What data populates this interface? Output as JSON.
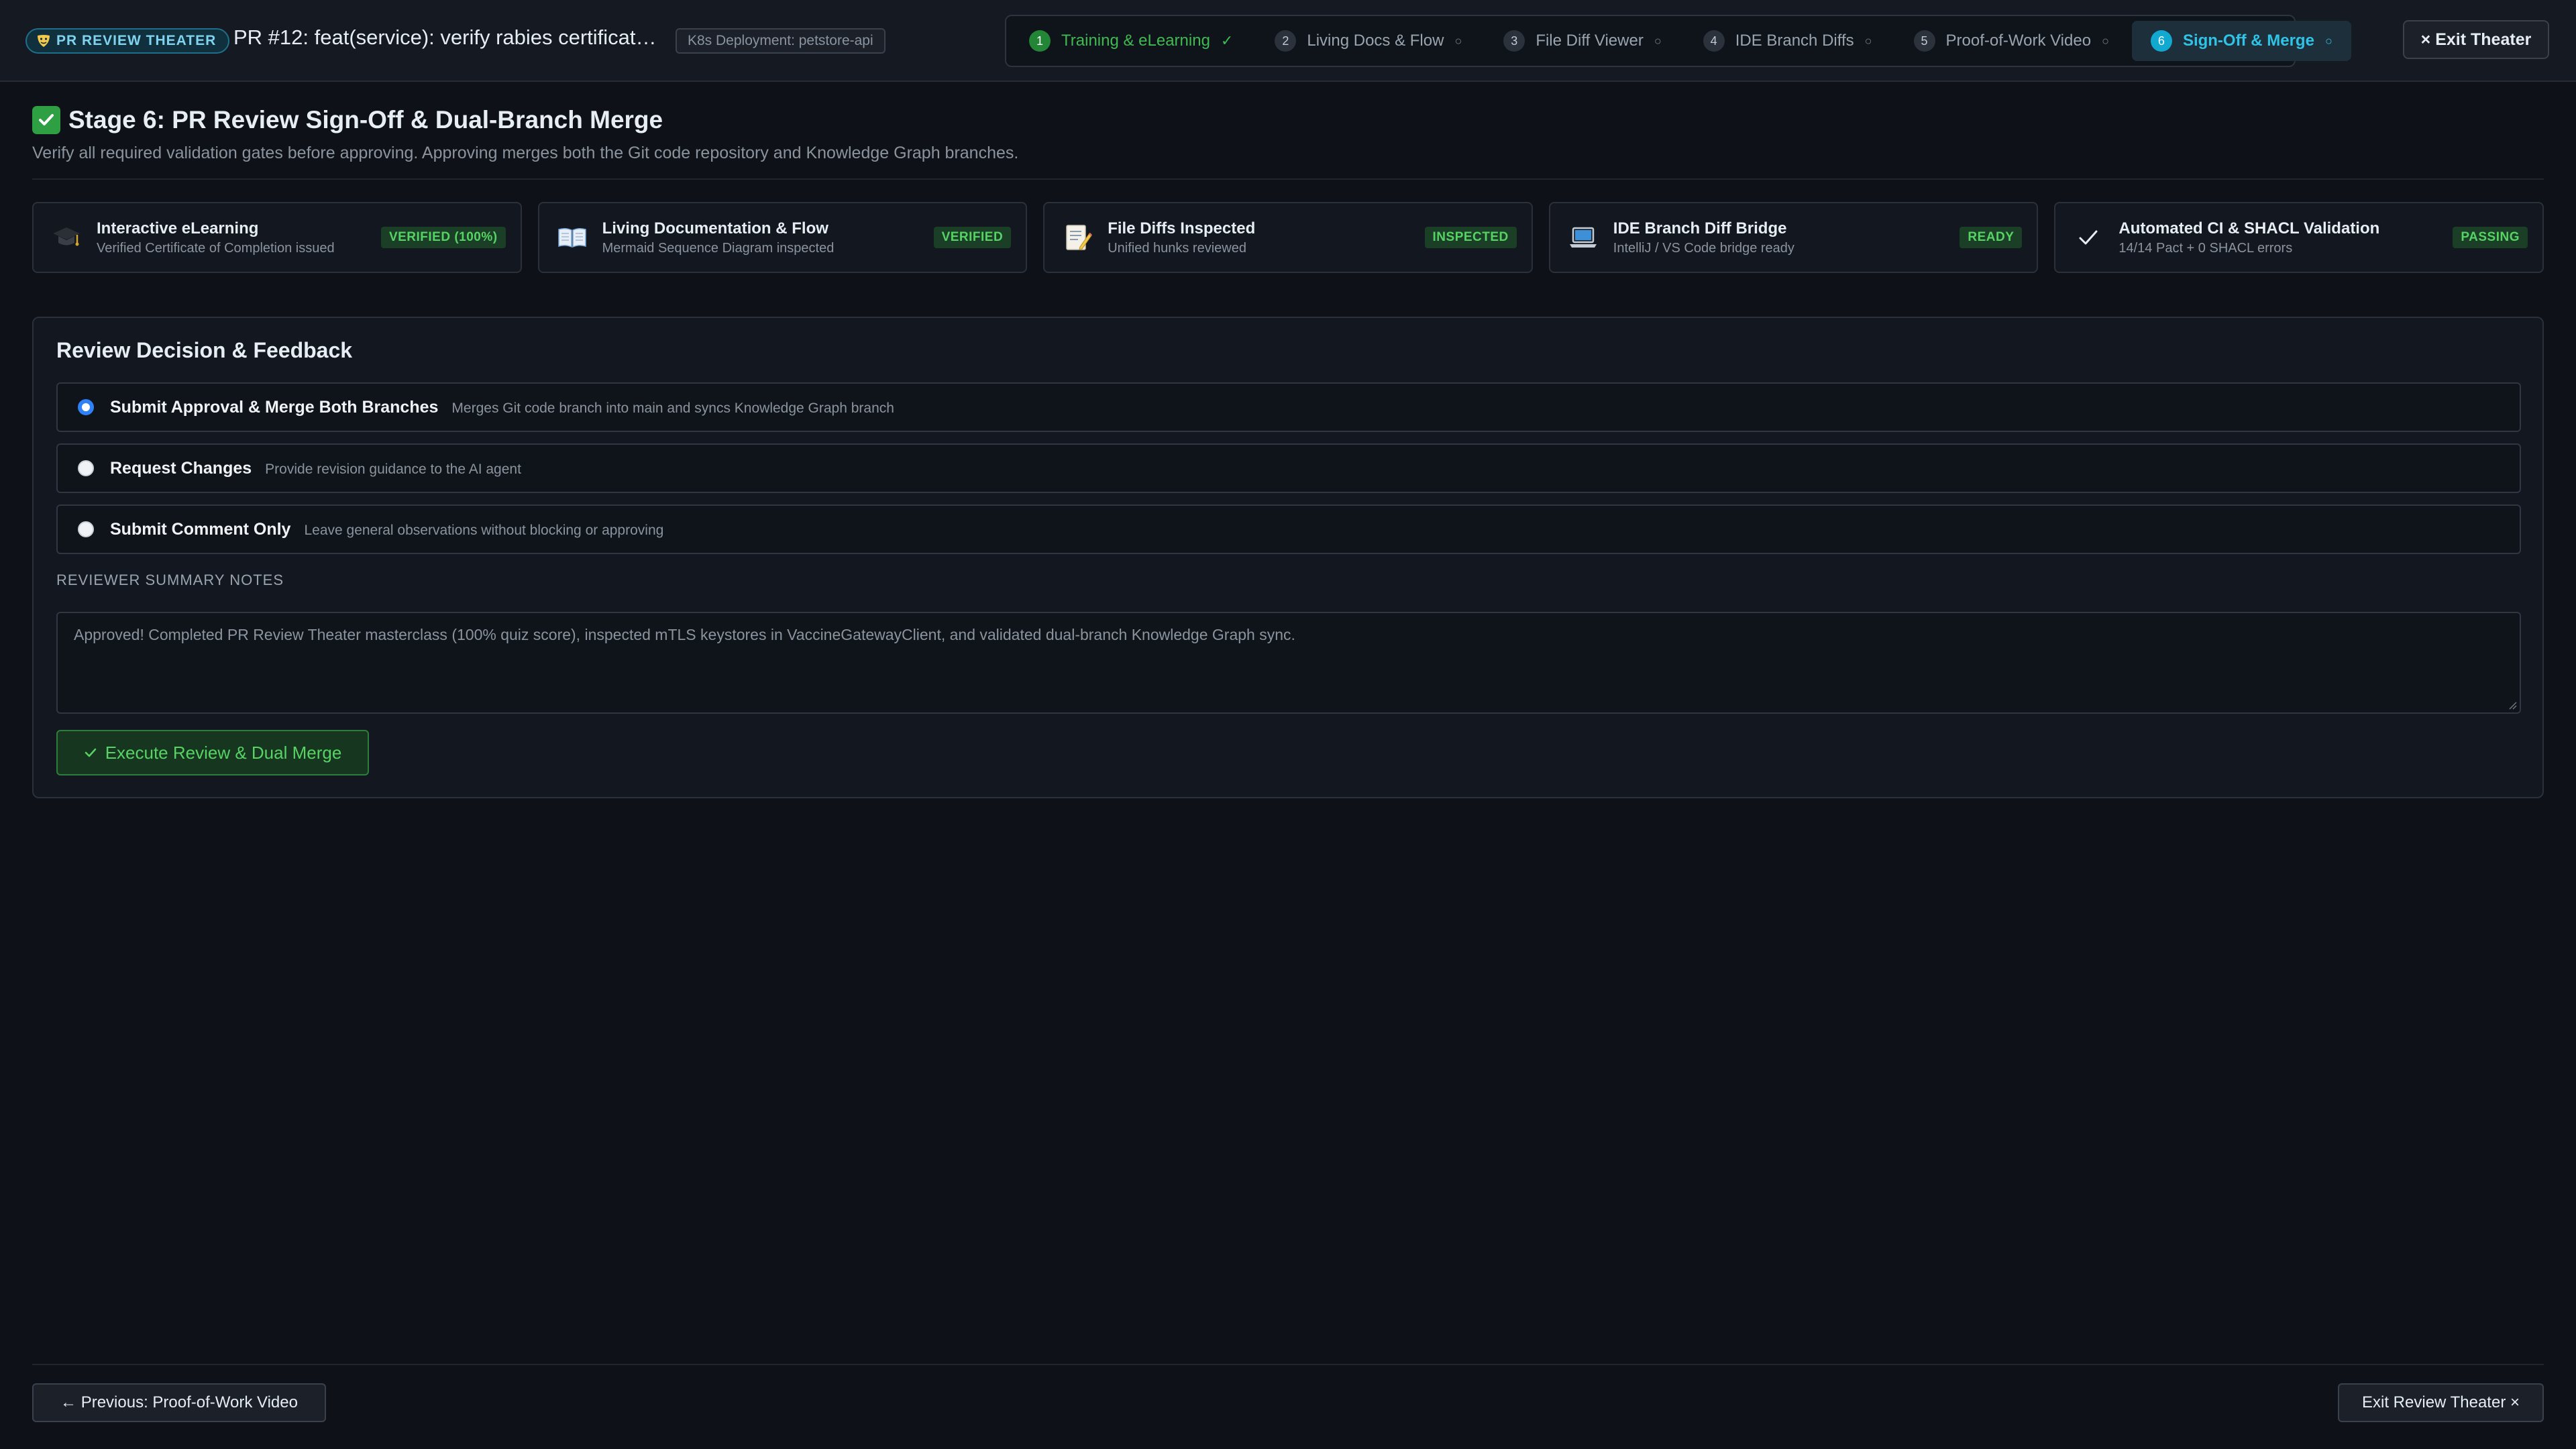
{
  "header": {
    "badge_label": "PR REVIEW THEATER",
    "pr_title": "PR #12: feat(service): verify rabies certificate o...",
    "deployment_tag": "K8s Deployment: petstore-api",
    "exit_label": "× Exit Theater"
  },
  "stepper": {
    "steps": [
      {
        "num": "1",
        "label": "Training & eLearning",
        "mark": "✓"
      },
      {
        "num": "2",
        "label": "Living Docs & Flow",
        "mark": "○"
      },
      {
        "num": "3",
        "label": "File Diff Viewer",
        "mark": "○"
      },
      {
        "num": "4",
        "label": "IDE Branch Diffs",
        "mark": "○"
      },
      {
        "num": "5",
        "label": "Proof-of-Work Video",
        "mark": "○"
      },
      {
        "num": "6",
        "label": "Sign-Off & Merge",
        "mark": "○"
      }
    ]
  },
  "stage": {
    "title": "Stage 6: PR Review Sign-Off & Dual-Branch Merge",
    "subtitle": "Verify all required validation gates before approving. Approving merges both the Git code repository and Knowledge Graph branches."
  },
  "gates": [
    {
      "icon": "graduation-cap-icon",
      "title": "Interactive eLearning",
      "desc": "Verified Certificate of Completion issued",
      "badge": "VERIFIED (100%)"
    },
    {
      "icon": "open-book-icon",
      "title": "Living Documentation & Flow",
      "desc": "Mermaid Sequence Diagram inspected",
      "badge": "VERIFIED"
    },
    {
      "icon": "memo-icon",
      "title": "File Diffs Inspected",
      "desc": "Unified hunks reviewed",
      "badge": "INSPECTED"
    },
    {
      "icon": "laptop-icon",
      "title": "IDE Branch Diff Bridge",
      "desc": "IntelliJ / VS Code bridge ready",
      "badge": "READY"
    },
    {
      "icon": "checkmark-icon",
      "title": "Automated CI & SHACL Validation",
      "desc": "14/14 Pact + 0 SHACL errors",
      "badge": "PASSING"
    }
  ],
  "decision": {
    "title": "Review Decision & Feedback",
    "options": [
      {
        "label": "Submit Approval & Merge Both Branches",
        "desc": "Merges Git code branch into main and syncs Knowledge Graph branch",
        "selected": true
      },
      {
        "label": "Request Changes",
        "desc": "Provide revision guidance to the AI agent",
        "selected": false
      },
      {
        "label": "Submit Comment Only",
        "desc": "Leave general observations without blocking or approving",
        "selected": false
      }
    ],
    "notes_label": "REVIEWER SUMMARY NOTES",
    "notes_value": "Approved! Completed PR Review Theater masterclass (100% quiz score), inspected mTLS keystores in VaccineGatewayClient, and validated dual-branch Knowledge Graph sync.",
    "execute_label": "Execute Review & Dual Merge"
  },
  "footer": {
    "prev_label": "← Previous: Proof-of-Work Video",
    "exit_label": "Exit Review Theater ×"
  },
  "colors": {
    "background": "#0e1218",
    "accent_cyan": "#2fc3e6",
    "success_green": "#3fb950",
    "radio_blue": "#2f81f7"
  }
}
